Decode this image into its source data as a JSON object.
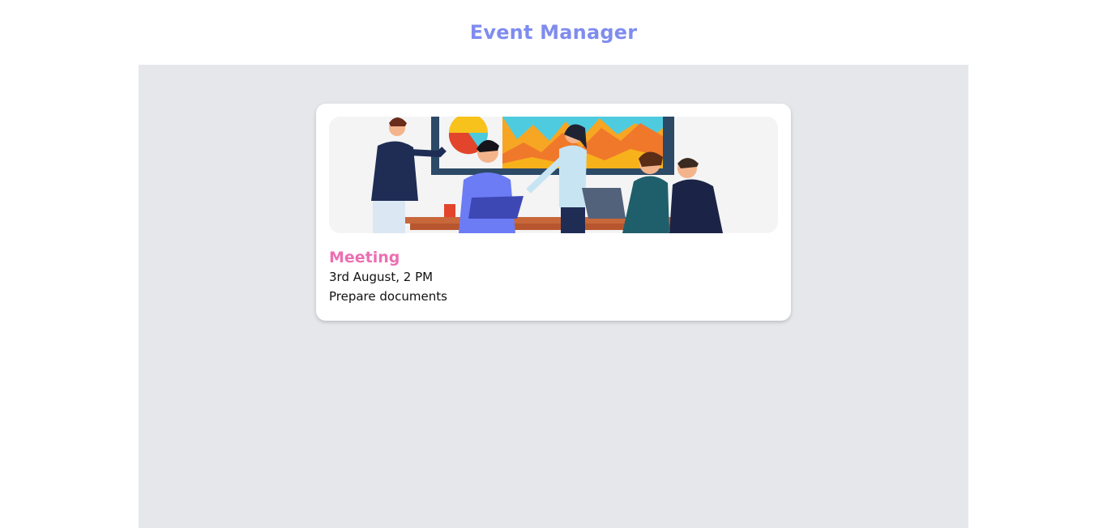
{
  "header": {
    "title": "Event Manager"
  },
  "events": [
    {
      "title": "Meeting",
      "date": "3rd August, 2 PM",
      "note": "Prepare documents",
      "image_icon": "team-meeting-illustration",
      "colors": {
        "title": "#ec6fb2"
      }
    }
  ],
  "colors": {
    "header_title": "#7f8cef",
    "main_background": "#e5e7eb",
    "card_background": "#ffffff"
  }
}
